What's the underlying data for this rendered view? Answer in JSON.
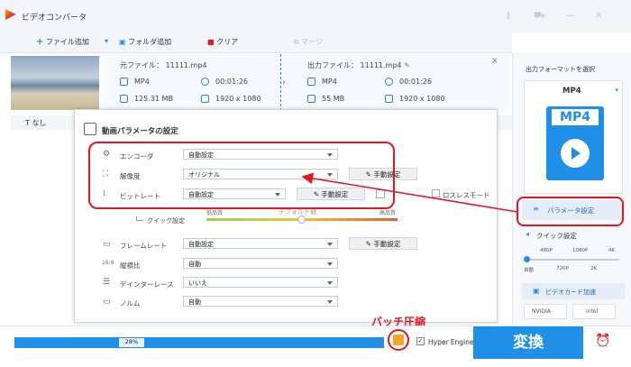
{
  "app": {
    "title": "ビデオコンバータ",
    "accent": "#1f8fe8",
    "highlight": "#e5161f"
  },
  "toolbar": {
    "add_file": "ファイル追加",
    "add_folder": "フォルダ追加",
    "clear": "クリア",
    "merge": "マージ"
  },
  "file": {
    "source_label": "元ファイル：",
    "source_name": "11111.mp4",
    "output_label": "出力ファイル：",
    "output_name": "11111.mp4",
    "src_format": "MP4",
    "src_duration": "00:01:26",
    "src_size": "125.31 MB",
    "src_resolution": "1920 x 1080",
    "out_format": "MP4",
    "out_duration": "00:01:26",
    "out_size": "55 MB",
    "out_resolution": "1920 x 1080",
    "subtitle": "なし"
  },
  "dialog": {
    "title": "動画パラメータの設定",
    "encoder_label": "エンコーダ",
    "encoder_value": "自動設定",
    "resolution_label": "解像度",
    "resolution_value": "オリジナル",
    "bitrate_label": "ビットレート",
    "bitrate_value": "自動設定",
    "lossless": "ロスレスモード",
    "quality_low": "低品質",
    "quality_default": "デフォルト値",
    "quality_high": "高品質",
    "quick_setting": "クイック設定",
    "framerate_label": "フレームレート",
    "framerate_value": "自動設定",
    "aspect_label": "縦横比",
    "aspect_value": "自動",
    "deinterlace_label": "デインターレース",
    "deinterlace_value": "いいえ",
    "norm_label": "ノルム",
    "norm_value": "自動",
    "manual": "手動設定"
  },
  "right": {
    "format_header": "出力フォーマットを選択",
    "format": "MP4",
    "param_button": "パラメータ設定",
    "quick_label": "クイック設定",
    "ticks_top": [
      "480P",
      "1080P",
      "4K"
    ],
    "ticks_bottom": [
      "自動",
      "720P",
      "2K"
    ],
    "gpu_button": "ビデオカード加速",
    "nvidia": "NVIDIA",
    "intel": "intel"
  },
  "bottom": {
    "progress": "28%",
    "progress_value": 0.28,
    "hyper": "Hyper Engine",
    "convert": "変換",
    "batch_label": "バッチ圧縮"
  }
}
